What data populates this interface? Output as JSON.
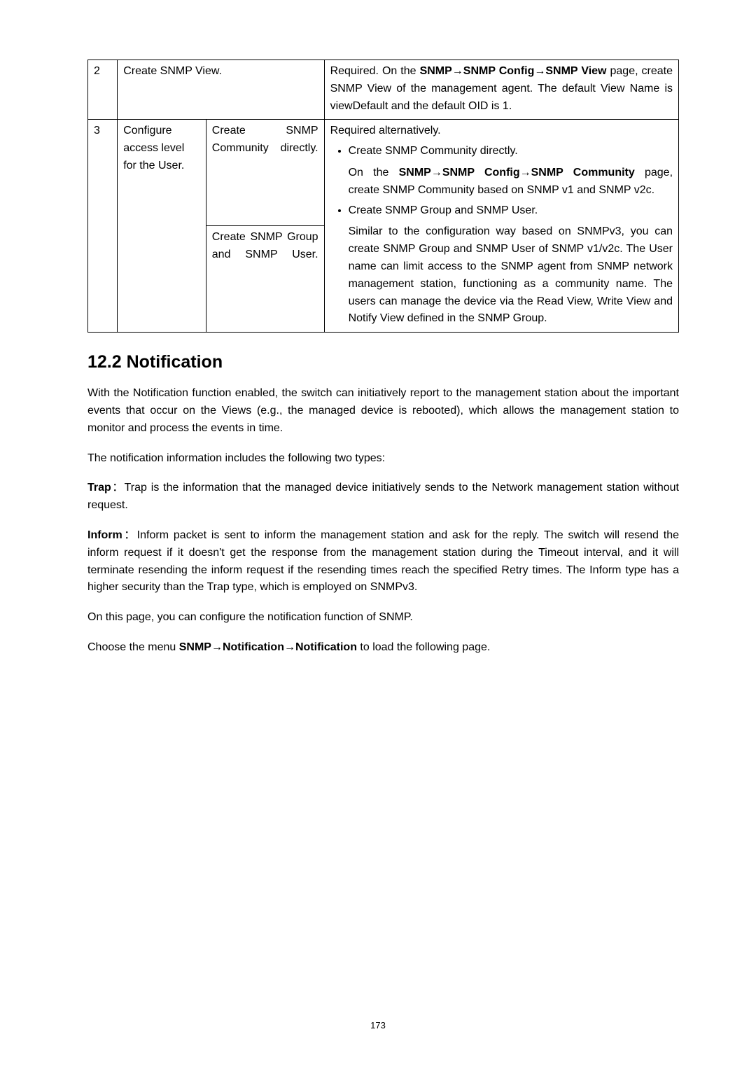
{
  "table": {
    "row2": {
      "num": "2",
      "task": "Create SNMP View.",
      "desc_pre": "Required. On the ",
      "desc_b1": "SNMP→SNMP Config→SNMP View",
      "desc_post": " page, create SNMP View of the management agent. The default View Name is viewDefault and the default OID is 1."
    },
    "row3": {
      "num": "3",
      "mid": "Configure access level for the User.",
      "sub1": "Create SNMP Community directly.",
      "sub2": "Create SNMP Group and SNMP User.",
      "desc_head": "Required alternatively.",
      "bullet1": "Create SNMP Community directly.",
      "b1_pre": "On the ",
      "b1_bold": "SNMP→SNMP Config→SNMP Community",
      "b1_post": " page, create SNMP Community based on SNMP v1 and SNMP v2c.",
      "bullet2": "Create SNMP Group and SNMP User.",
      "b2_body": "Similar to the configuration way based on SNMPv3, you can create SNMP Group and SNMP User of SNMP v1/v2c. The User name can limit access to the SNMP agent from SNMP network management station, functioning as a community name. The users can manage the device via the Read View, Write View and Notify View defined in the SNMP Group."
    }
  },
  "section_heading": "12.2 Notification",
  "p1": "With the Notification function enabled, the switch can initiatively report to the management station about the important events that occur on the Views (e.g., the managed device is rebooted), which allows the management station to monitor and process the events in time.",
  "p2": "The notification information includes the following two types:",
  "trap_label": "Trap",
  "trap_sep": "：",
  "trap_body": "Trap is the information that the managed device initiatively sends to the Network management station without request.",
  "inform_label": "Inform",
  "inform_sep": "：",
  "inform_body": "Inform packet is sent to inform the management station and ask for the reply. The switch will resend the inform request if it doesn't get the response from the management station during the Timeout interval, and it will terminate resending the inform request if the resending times reach the specified Retry times. The Inform type has a higher security than the Trap type, which is employed on SNMPv3.",
  "p5": "On this page, you can configure the notification function of SNMP.",
  "p6_pre": "Choose the menu ",
  "p6_bold": "SNMP→Notification→Notification",
  "p6_post": " to load the following page.",
  "page_number": "173"
}
